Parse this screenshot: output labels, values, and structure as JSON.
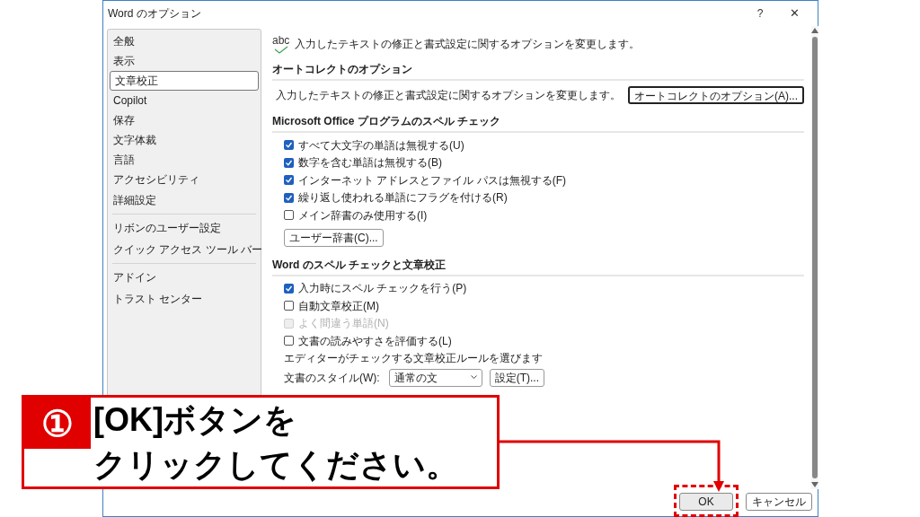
{
  "window": {
    "title": "Word のオプション",
    "help": "?",
    "close": "✕"
  },
  "sidebar": {
    "groups": [
      [
        {
          "label": "全般",
          "selected": false
        },
        {
          "label": "表示",
          "selected": false
        },
        {
          "label": "文章校正",
          "selected": true
        },
        {
          "label": "Copilot",
          "selected": false
        },
        {
          "label": "保存",
          "selected": false
        },
        {
          "label": "文字体裁",
          "selected": false
        },
        {
          "label": "言語",
          "selected": false
        },
        {
          "label": "アクセシビリティ",
          "selected": false
        },
        {
          "label": "詳細設定",
          "selected": false
        }
      ],
      [
        {
          "label": "リボンのユーザー設定",
          "selected": false
        },
        {
          "label": "クイック アクセス ツール バー",
          "selected": false
        }
      ],
      [
        {
          "label": "アドイン",
          "selected": false
        },
        {
          "label": "トラスト センター",
          "selected": false
        }
      ]
    ]
  },
  "intro": {
    "icon_text": "abc",
    "text": "入力したテキストの修正と書式設定に関するオプションを変更します。"
  },
  "sections": [
    {
      "title": "オートコレクトのオプション",
      "items": [
        {
          "kind": "text_button",
          "text": "入力したテキストの修正と書式設定に関するオプションを変更します。",
          "button": "オートコレクトのオプション(A)...",
          "focused": true
        }
      ]
    },
    {
      "title": "Microsoft Office プログラムのスペル チェック",
      "items": [
        {
          "kind": "checkbox",
          "label": "すべて大文字の単語は無視する(U)",
          "checked": true,
          "disabled": false
        },
        {
          "kind": "checkbox",
          "label": "数字を含む単語は無視する(B)",
          "checked": true,
          "disabled": false
        },
        {
          "kind": "checkbox",
          "label": "インターネット アドレスとファイル パスは無視する(F)",
          "checked": true,
          "disabled": false
        },
        {
          "kind": "checkbox",
          "label": "繰り返し使われる単語にフラグを付ける(R)",
          "checked": true,
          "disabled": false
        },
        {
          "kind": "checkbox",
          "label": "メイン辞書のみ使用する(I)",
          "checked": false,
          "disabled": false
        },
        {
          "kind": "button",
          "label": "ユーザー辞書(C)..."
        }
      ]
    },
    {
      "title": "Word のスペル チェックと文章校正",
      "items": [
        {
          "kind": "checkbox",
          "label": "入力時にスペル チェックを行う(P)",
          "checked": true,
          "disabled": false
        },
        {
          "kind": "checkbox",
          "label": "自動文章校正(M)",
          "checked": false,
          "disabled": false
        },
        {
          "kind": "checkbox",
          "label": "よく間違う単語(N)",
          "checked": false,
          "disabled": true
        },
        {
          "kind": "checkbox",
          "label": "文書の読みやすさを評価する(L)",
          "checked": false,
          "disabled": false
        },
        {
          "kind": "text",
          "label": "エディターがチェックする文章校正ルールを選びます"
        },
        {
          "kind": "select_row",
          "label": "文書のスタイル(W):",
          "value": "通常の文",
          "button": "設定(T)..."
        }
      ]
    }
  ],
  "buttons": [
    {
      "label": "OK",
      "highlighted": true
    },
    {
      "label": "キャンセル",
      "highlighted": false
    }
  ],
  "callout": {
    "number": "①",
    "lines": [
      "[OK]ボタンを",
      "クリックしてください。"
    ]
  }
}
